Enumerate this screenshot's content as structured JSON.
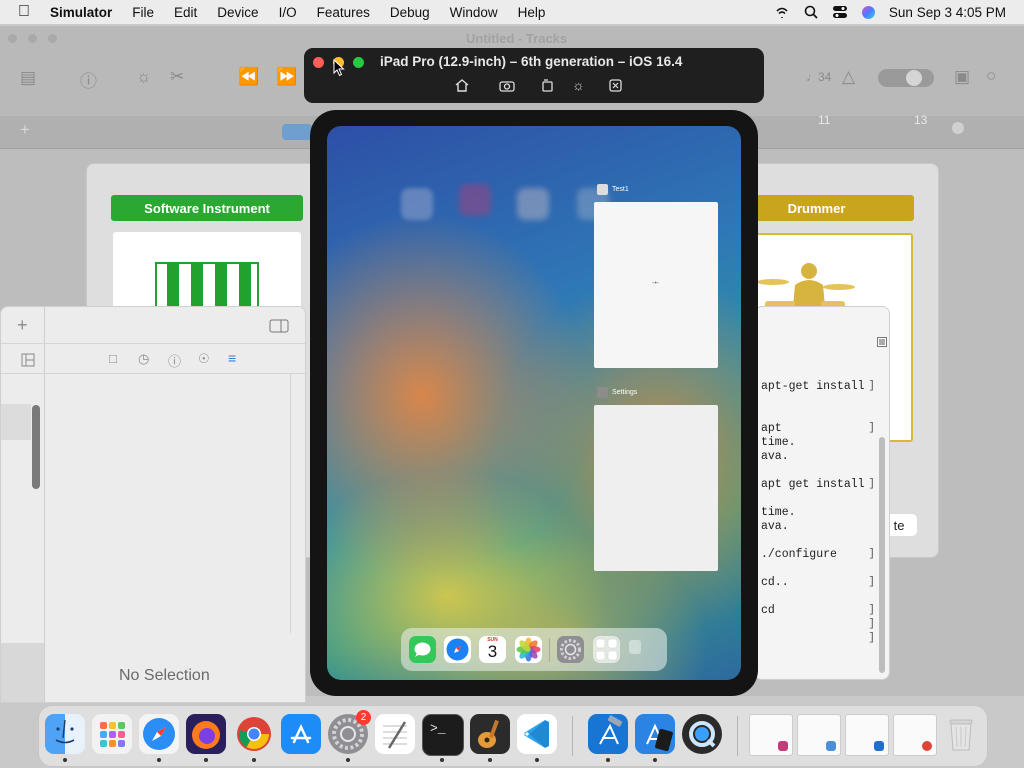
{
  "menubar": {
    "app_name": "Simulator",
    "items": [
      "File",
      "Edit",
      "Device",
      "I/O",
      "Features",
      "Debug",
      "Window",
      "Help"
    ],
    "datetime": "Sun Sep 3  4:05 PM"
  },
  "garageband": {
    "window_title": "Untitled - Tracks",
    "ruler_marks": [
      "11",
      "13"
    ],
    "tempo_value": "♩34"
  },
  "chooser": {
    "software_instrument_label": "Software Instrument",
    "drummer_label": "Drummer",
    "software_color": "#2aa832",
    "drummer_color": "#c9a51e",
    "create_partial": "te"
  },
  "inspector": {
    "no_selection": "No Selection"
  },
  "terminal": {
    "lines": [
      "apt-get install",
      "apt",
      "time.",
      "ava.",
      "apt get install",
      "time.",
      "ava.",
      "./configure",
      "cd..",
      "cd"
    ],
    "partial_h": "h"
  },
  "simulator": {
    "title": "iPad Pro (12.9-inch) – 6th generation – iOS 16.4",
    "tools": [
      "home-icon",
      "screenshot-icon",
      "rotate-icon",
      "appearance-icon",
      "keyboard-icon"
    ]
  },
  "ipad": {
    "card1_label": "Test1",
    "card2_label": "Settings",
    "calendar_day_name": "SUN",
    "calendar_day": "3"
  },
  "dock": {
    "apps": [
      "Finder",
      "Launchpad",
      "Safari",
      "Firefox",
      "Chrome",
      "App Store",
      "System Settings",
      "TextEdit",
      "Terminal",
      "GarageBand",
      "Visual Studio Code",
      "Xcode",
      "Simulator",
      "QuickTime Player"
    ],
    "settings_badge": "2"
  }
}
